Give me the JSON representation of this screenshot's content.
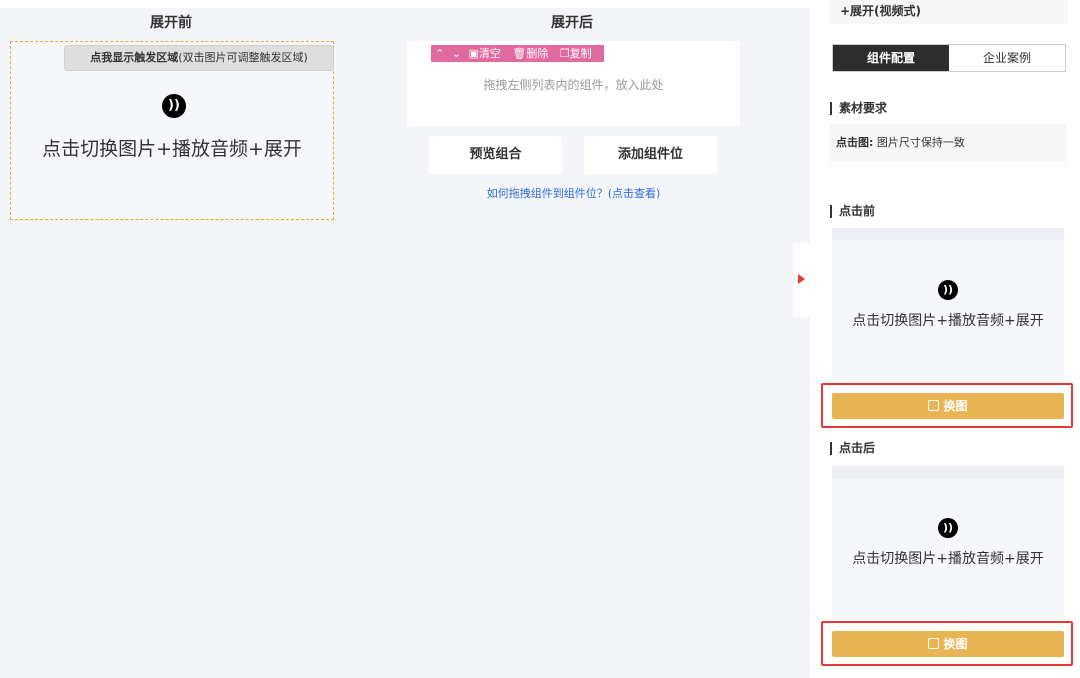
{
  "canvas": {
    "before_title": "展开前",
    "after_title": "展开后",
    "trigger_button": {
      "bold": "点我显示触发区域",
      "normal": "(双击图片可调整触发区域)"
    },
    "before_text": "点击切换图片+播放音频+展开",
    "toolbar": {
      "up": "⌃",
      "down": "⌄",
      "clear": "清空",
      "delete": "删除",
      "copy": "复制"
    },
    "drop_hint": "拖拽左侧列表内的组件，放入此处",
    "preview_button": "预览组合",
    "add_slot_button": "添加组件位",
    "help_link": "如何拖拽组件到组件位？(点击查看)"
  },
  "panel": {
    "header": "+展开(视频式)",
    "tabs": [
      {
        "label": "组件配置",
        "active": true
      },
      {
        "label": "企业案例",
        "active": false
      }
    ],
    "material_title": "素材要求",
    "requirement_label": "点击图:",
    "requirement_text": "图片尺寸保持一致",
    "before_title": "点击前",
    "before_preview_text": "点击切换图片+播放音频+展开",
    "swap_label_1": "换图",
    "after_title": "点击后",
    "after_preview_text": "点击切换图片+播放音频+展开",
    "swap_label_2": "换图"
  },
  "colors": {
    "accent_pink": "#e06a9f",
    "swap_yellow": "#e9b454",
    "highlight_red": "#e53935",
    "link_blue": "#2f6bd8",
    "dashed_border": "#e8a73a"
  },
  "icons": [
    "audio-icon",
    "chevron-up-icon",
    "chevron-down-icon",
    "clear-icon",
    "trash-icon",
    "copy-icon",
    "expand-arrow-icon",
    "image-swap-icon"
  ]
}
